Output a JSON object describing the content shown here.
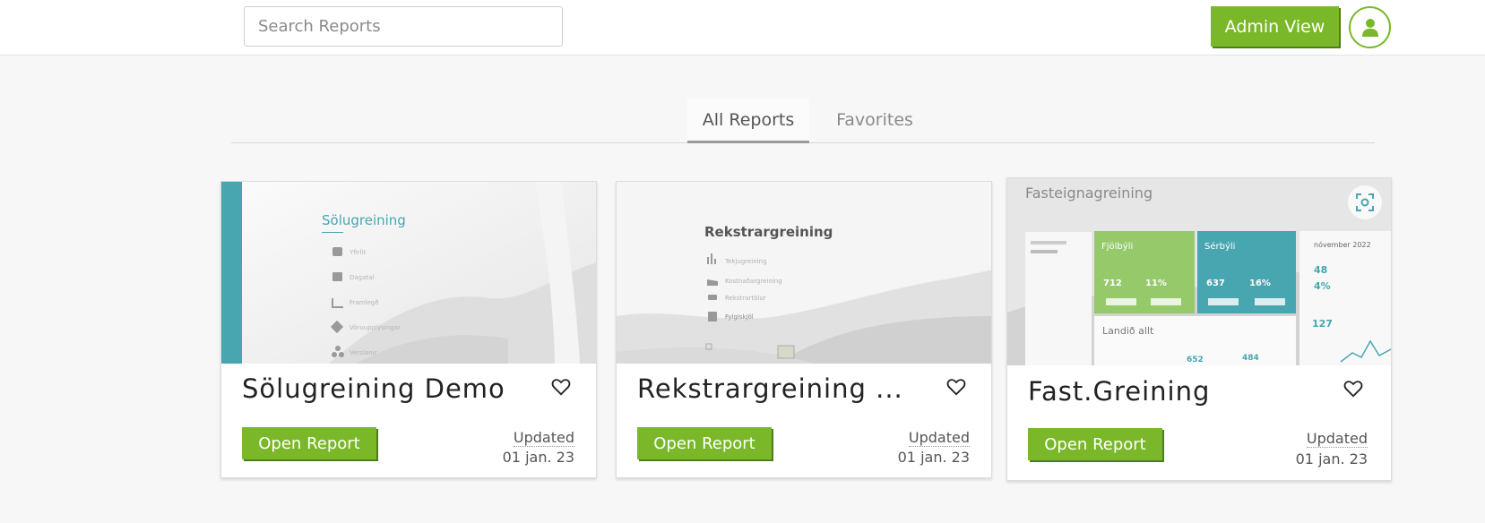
{
  "header": {
    "search_placeholder": "Search Reports",
    "admin_button": "Admin View",
    "avatar_icon": "user-icon"
  },
  "tabs": [
    {
      "label": "All Reports",
      "active": true
    },
    {
      "label": "Favorites",
      "active": false
    }
  ],
  "reports": [
    {
      "title": "Sölugreining Demo",
      "open_label": "Open Report",
      "updated_label": "Updated",
      "updated_date": "01 jan. 23",
      "favorite_icon": "heart-outline-icon",
      "thumbnail": {
        "heading": "Sölugreining",
        "menu": [
          "Yfirlit",
          "Dagatal",
          "Framlegð",
          "Vöruupplýsingar",
          "Verslanir"
        ]
      }
    },
    {
      "title": "Rekstrargreining ...",
      "open_label": "Open Report",
      "updated_label": "Updated",
      "updated_date": "01 jan. 23",
      "favorite_icon": "heart-outline-icon",
      "thumbnail": {
        "heading": "Rekstrargreining",
        "menu": [
          "Tekjugreining",
          "Kostnaðargreining",
          "Rekstrartölur",
          "Fylgiskjöl"
        ]
      }
    },
    {
      "title": "Fast.Greining",
      "open_label": "Open Report",
      "updated_label": "Updated",
      "updated_date": "01 jan. 23",
      "favorite_icon": "heart-outline-icon",
      "thumbnail": {
        "heading": "Fasteignagreining",
        "kpi_tiles": [
          {
            "label": "Fjölbýli",
            "value": "712",
            "pct": "11%"
          },
          {
            "label": "Sérbýli",
            "value": "637",
            "pct": "16%"
          }
        ],
        "country_label": "Landið allt",
        "country_values": [
          "652",
          "484"
        ],
        "side_month": "nóvember 2022",
        "side_values": [
          "48",
          "4%",
          "127"
        ],
        "preview_icon": "focus-frame-icon"
      }
    }
  ],
  "colors": {
    "accent": "#7ab82a",
    "teal": "#48a6b0",
    "green_tile": "#95c96a"
  }
}
